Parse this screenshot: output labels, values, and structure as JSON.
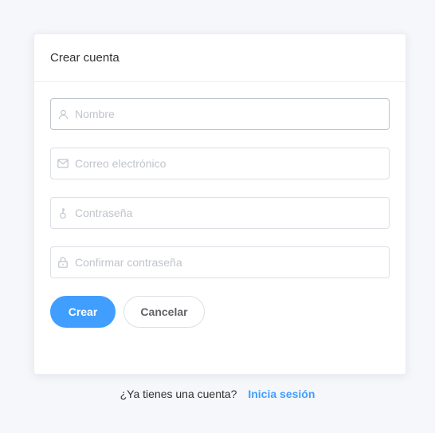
{
  "card": {
    "title": "Crear cuenta"
  },
  "form": {
    "fields": [
      {
        "icon": "user-icon",
        "placeholder": "Nombre",
        "value": ""
      },
      {
        "icon": "mail-icon",
        "placeholder": "Correo electrónico",
        "value": ""
      },
      {
        "icon": "key-icon",
        "placeholder": "Contraseña",
        "value": ""
      },
      {
        "icon": "lock-icon",
        "placeholder": "Confirmar contraseña",
        "value": ""
      }
    ],
    "submit_label": "Crear",
    "cancel_label": "Cancelar"
  },
  "footer": {
    "question": "¿Ya tienes una cuenta?",
    "link": "Inicia sesión"
  },
  "colors": {
    "primary": "#409eff",
    "border": "#dcdfe6",
    "placeholder": "#c0c4cc"
  }
}
